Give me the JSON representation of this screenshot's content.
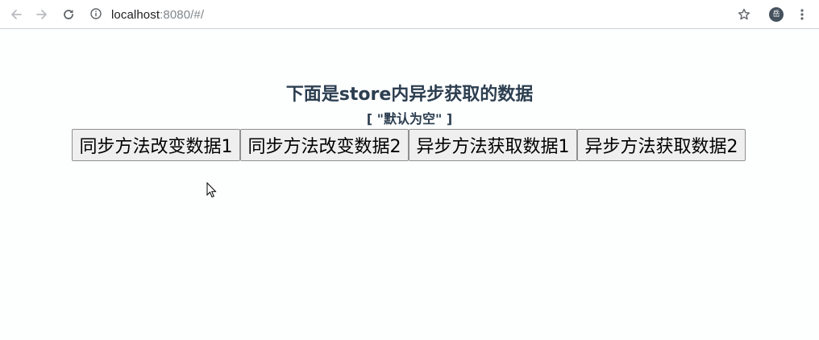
{
  "browser": {
    "url_host": "localhost",
    "url_rest": ":8080/#/",
    "avatar_letter": "岳"
  },
  "page": {
    "heading": "下面是store内异步获取的数据",
    "state_value": "[ \"默认为空\" ]",
    "buttons": [
      {
        "label": "同步方法改变数据1"
      },
      {
        "label": "同步方法改变数据2"
      },
      {
        "label": "异步方法获取数据1"
      },
      {
        "label": "异步方法获取数据2"
      }
    ]
  },
  "icons": {
    "back": "back-arrow-icon",
    "forward": "forward-arrow-icon",
    "reload": "reload-icon",
    "info": "info-icon",
    "bookmark": "star-icon",
    "menu": "kebab-menu-icon"
  },
  "colors": {
    "text": "#2c3e50",
    "button_bg": "#efefef",
    "button_border": "#8f8f8f",
    "avatar_bg": "#45525e"
  }
}
